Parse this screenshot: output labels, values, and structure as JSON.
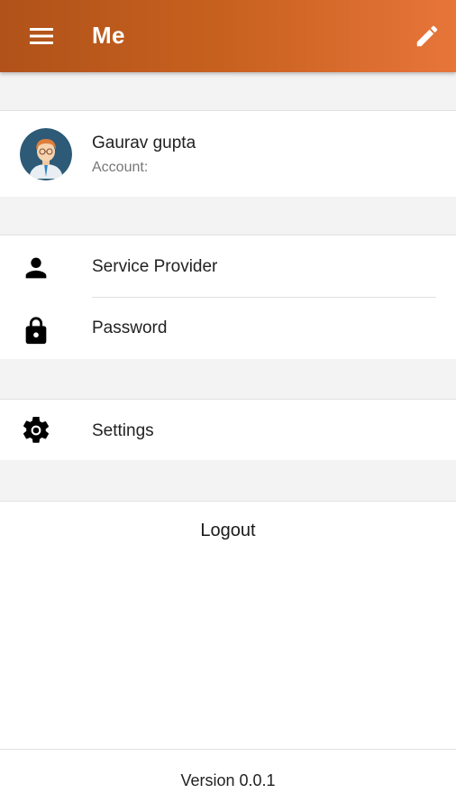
{
  "appbar": {
    "title": "Me",
    "menu_icon": "menu-icon",
    "edit_icon": "pencil-icon",
    "gradient_start": "#b0521a",
    "gradient_end": "#e7753a"
  },
  "profile": {
    "name": "Gaurav gupta",
    "account_label": "Account:",
    "avatar_icon": "user-avatar"
  },
  "menu": {
    "items": [
      {
        "label": "Service Provider",
        "icon": "person-icon"
      },
      {
        "label": "Password",
        "icon": "lock-icon"
      },
      {
        "label": "Settings",
        "icon": "gear-icon"
      }
    ]
  },
  "logout": {
    "label": "Logout"
  },
  "footer": {
    "version": "Version 0.0.1"
  }
}
